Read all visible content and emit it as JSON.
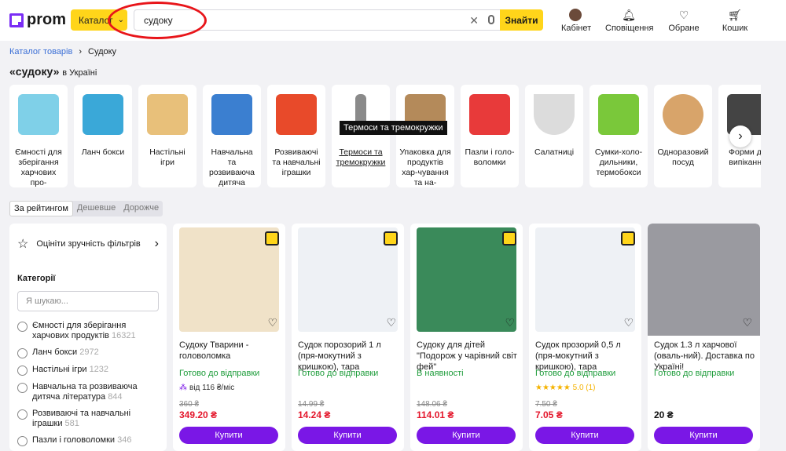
{
  "header": {
    "logo": "prom",
    "catalog_label": "Каталог",
    "search": {
      "value": "судоку",
      "placeholder": ""
    },
    "find_label": "Знайти",
    "nav": [
      {
        "label": "Кабінет",
        "icon": "avatar-icon"
      },
      {
        "label": "Сповіщення",
        "icon": "bell-icon"
      },
      {
        "label": "Обране",
        "icon": "heart-icon"
      },
      {
        "label": "Кошик",
        "icon": "cart-icon"
      }
    ]
  },
  "breadcrumb": {
    "root": "Каталог товарів",
    "current": "Судоку"
  },
  "page_title": {
    "query": "«судоку»",
    "suffix": "в Україні"
  },
  "categories": [
    {
      "label": "Ємності для зберігання харчових про-",
      "color": "#7fd0e8"
    },
    {
      "label": "Ланч бокси",
      "color": "#3aa8d8"
    },
    {
      "label": "Настільні ігри",
      "color": "#e8c07a"
    },
    {
      "label": "Навчальна та розвиваюча дитяча літера-",
      "color": "#3b7fd0"
    },
    {
      "label": "Розвиваючі та навчальні іграшки",
      "color": "#e84a2a"
    },
    {
      "label": "Термоси та тремокружки",
      "color": "#8a8a8a"
    },
    {
      "label": "Упаковка для продуктів хар-чування та на-",
      "color": "#b48a5a"
    },
    {
      "label": "Пазли і голо-воломки",
      "color": "#e83a3a"
    },
    {
      "label": "Салатниці",
      "color": "#dcdcdc"
    },
    {
      "label": "Сумки-холо-дильники, термобокси",
      "color": "#7ac83a"
    },
    {
      "label": "Одноразовий посуд",
      "color": "#d8a46a"
    },
    {
      "label": "Форми дл випікання",
      "color": "#444444"
    }
  ],
  "tooltip": "Термоси та тремокружки",
  "sort": [
    "За рейтингом",
    "Дешевше",
    "Дорожче"
  ],
  "filters": {
    "rate_label": "Оцініти зручність фільтрів",
    "categories_title": "Категорії",
    "search_placeholder": "Я шукаю...",
    "items": [
      {
        "label": "Ємності для зберігання харчових продуктів",
        "count": "16321"
      },
      {
        "label": "Ланч бокси",
        "count": "2972"
      },
      {
        "label": "Настільні ігри",
        "count": "1232"
      },
      {
        "label": "Навчальна та розвиваюча дитяча література",
        "count": "844"
      },
      {
        "label": "Розвиваючі та навчальні іграшки",
        "count": "581"
      },
      {
        "label": "Пазли і головоломки",
        "count": "346"
      }
    ]
  },
  "products": [
    {
      "name": "Судоку Тварини - головоломка",
      "availability": "Готово до відправки",
      "extra": "від 116 ₴/міс",
      "old_price": "360 ₴",
      "price": "349.20 ₴",
      "buy": "Купити",
      "img": "#f0e2c8"
    },
    {
      "name": "Судок порозорий 1 л (пря-мокутний з кришкою), тара",
      "availability": "Готово до відправки",
      "extra": "",
      "old_price": "14.99 ₴",
      "price": "14.24 ₴",
      "buy": "Купити",
      "img": "#eef1f5"
    },
    {
      "name": "Судоку для дітей \"Подорож у чарівний світ фей\"",
      "availability": "В наявності",
      "extra": "",
      "old_price": "148.06 ₴",
      "price": "114.01 ₴",
      "buy": "Купити",
      "img": "#3a8a5a"
    },
    {
      "name": "Судок прозорий 0,5 л (пря-мокутний з кришкою), тара",
      "availability": "Готово до відправки",
      "extra": "★★★★★ 5.0 (1)",
      "old_price": "7.50 ₴",
      "price": "7.05 ₴",
      "buy": "Купити",
      "img": "#eef1f5"
    },
    {
      "name": "Судок 1.3 л харчової (оваль-ний). Доставка по Україні!",
      "availability": "Готово до відправки",
      "extra": "",
      "old_price": "",
      "price": "20 ₴",
      "buy": "Купити",
      "img": "#9a9aa0"
    }
  ]
}
